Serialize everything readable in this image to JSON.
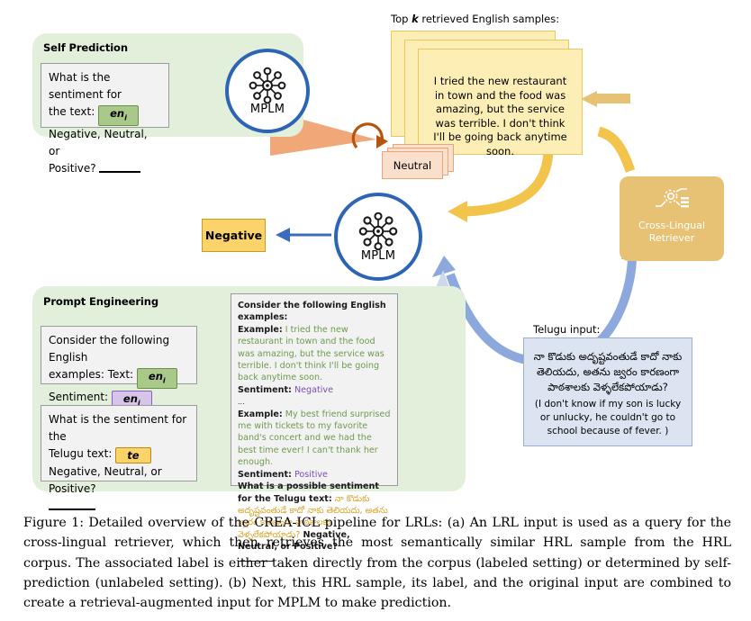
{
  "figure": {
    "self_prediction": {
      "title": "Self Prediction",
      "prompt_line1": "What is the sentiment for",
      "prompt_line2_prefix": "the text:",
      "badge_en": "en",
      "badge_en_sub": "i",
      "prompt_line3": "Negative, Neutral, or",
      "prompt_line4": "Positive?"
    },
    "mplm_top": {
      "label": "MPLM",
      "icon": "neural-network-icon"
    },
    "mplm_main": {
      "label": "MPLM",
      "icon": "neural-network-icon"
    },
    "retrieved": {
      "heading_prefix": "Top ",
      "heading_k": "k",
      "heading_suffix": " retrieved English samples:",
      "sample_text": "I tried the new restaurant in town and the food was amazing, but the service was terrible. I don't think I'll be going back anytime soon."
    },
    "pseudo_label": {
      "label": "Neutral"
    },
    "retriever": {
      "line1": "Cross-Lingual",
      "line2": "Retriever",
      "icon": "gear-network-icon"
    },
    "prediction": {
      "label": "Negative"
    },
    "telugu_input": {
      "caption": "Telugu input:",
      "native": "నా కొడుకు అదృష్టవంతుడే కాదో నాకు తెలియదు, అతను జ్వరం కారణంగా పాఠశాలకు వెళ్ళలేకపోయాడు?",
      "gloss": "(I don't know if my son is lucky or unlucky, he couldn't go to school because of fever. )"
    },
    "prompt_engineering": {
      "title": "Prompt Engineering",
      "box_a": {
        "line1": "Consider the following English",
        "line2_prefix": "examples: Text:",
        "badge_text": "en",
        "badge_text_sub": "i",
        "line3_prefix": "Sentiment:",
        "badge_sentiment": "en",
        "badge_sentiment_sub": "i"
      },
      "box_b": {
        "line1": "What is the sentiment for the",
        "line2_prefix": "Telugu text:",
        "badge_te": "te",
        "line3": "Negative, Neutral, or Positive?"
      }
    },
    "composed_prompt": {
      "header": "Consider the following English examples:",
      "example1_label": "Example:",
      "example1_text": "I tried the new restaurant in town and the food was amazing, but the service was terrible. I don't think I'll be going back anytime soon.",
      "sentiment1_label": "Sentiment:",
      "sentiment1_value": "Negative",
      "ellipsis": "...",
      "example2_label": "Example:",
      "example2_text": "My best friend surprised me with tickets to my favorite band's concert and we had the best time ever! I can't thank her enough.",
      "sentiment2_label": "Sentiment:",
      "sentiment2_value": "Positive",
      "question_prefix": "What is a possible sentiment for the Telugu text:",
      "question_telugu": "నా కొడుకు అదృష్టవంతుడే కాదో నాకు తెలియదు, అతను జ్వరం కారణంగా పాఠశాలకు వెళ్ళలేకపోయాడు?",
      "question_suffix": "Negative, Neutral, or Positive?"
    },
    "colors": {
      "panel_green": "#e2efda",
      "card_yellow": "#fdeeb6",
      "card_peach": "#fadfcd",
      "retriever_gold": "#e8c274",
      "mplm_blue": "#2e64b4",
      "arrow_yellow": "#f2c44c",
      "arrow_blue": "#8ca8dc",
      "arrow_orange": "#f0a878",
      "arrow_brown": "#b5540f",
      "chip_yellow": "#fbd36b",
      "telugu_box_blue": "#dce4f2"
    }
  },
  "caption": {
    "text": "Figure 1: Detailed overview of the CREA-ICL pipeline for LRLs: (a) An LRL input is used as a query for the cross-lingual retriever, which then retrieves the most semantically similar HRL sample from the HRL corpus. The associated label is either taken directly from the corpus (labeled setting) or determined by self-prediction (unlabeled setting). (b) Next, this HRL sample, its label, and the original input are combined to create a retrieval-augmented input for MPLM to make prediction."
  }
}
